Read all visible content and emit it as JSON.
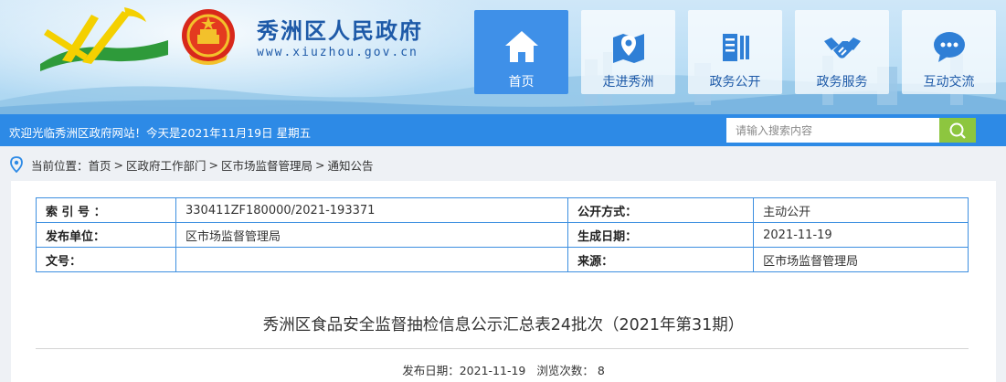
{
  "header": {
    "site_title": "秀洲区人民政府",
    "site_url": "www.xiuzhou.gov.cn",
    "colors": {
      "brand_blue": "#1e5aa8",
      "nav_active": "#3f90e8",
      "bar_blue": "#2d8ae6",
      "search_green": "#8dc63f"
    }
  },
  "nav": {
    "items": [
      {
        "label": "首页",
        "icon": "home-icon",
        "active": true
      },
      {
        "label": "走进秀洲",
        "icon": "map-pin-icon",
        "active": false
      },
      {
        "label": "政务公开",
        "icon": "document-icon",
        "active": false
      },
      {
        "label": "政务服务",
        "icon": "handshake-icon",
        "active": false
      },
      {
        "label": "互动交流",
        "icon": "chat-icon",
        "active": false
      }
    ]
  },
  "topbar": {
    "welcome": "欢迎光临秀洲区政府网站！今天是2021年11月19日 星期五",
    "search_placeholder": "请输入搜索内容"
  },
  "breadcrumb": {
    "prefix": "当前位置：",
    "items": [
      "首页",
      "区政府工作部门",
      "区市场监督管理局",
      "通知公告"
    ],
    "separator": " > "
  },
  "meta_table": {
    "rows": [
      {
        "k1": "索 引 号 ：",
        "v1": "330411ZF180000/2021-193371",
        "k2": "公开方式：",
        "v2": "主动公开"
      },
      {
        "k1": "发布单位：",
        "v1": "区市场监督管理局",
        "k2": "生成日期：",
        "v2": "2021-11-19"
      },
      {
        "k1": "文号：",
        "v1": "",
        "k2": "来源：",
        "v2": "区市场监督管理局"
      }
    ]
  },
  "article": {
    "title": "秀洲区食品安全监督抽检信息公示汇总表24批次（2021年第31期）",
    "publish_label": "发布日期：",
    "publish_date": "2021-11-19",
    "views_label": "浏览次数：",
    "views": "8"
  }
}
